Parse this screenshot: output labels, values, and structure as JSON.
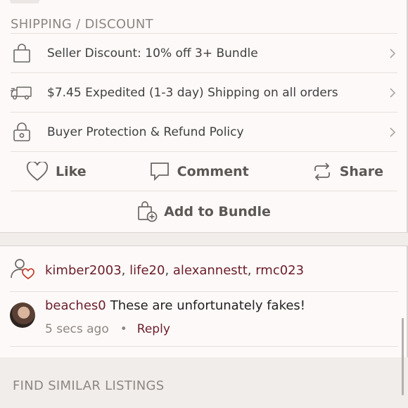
{
  "shipping": {
    "title": "SHIPPING / DISCOUNT",
    "rows": [
      {
        "icon": "shopping-bag-icon",
        "label": "Seller Discount: 10% off 3+ Bundle"
      },
      {
        "icon": "truck-icon",
        "label": "$7.45 Expedited (1-3 day) Shipping on all orders"
      },
      {
        "icon": "lock-icon",
        "label": "Buyer Protection & Refund Policy"
      }
    ]
  },
  "actions": {
    "like": "Like",
    "comment": "Comment",
    "share": "Share",
    "add_to_bundle": "Add to Bundle"
  },
  "likers": {
    "icon": "user-heart-icon",
    "names": [
      "kimber2003",
      "life20",
      "alexannestt",
      "rmc023"
    ]
  },
  "comment": {
    "user": "beaches0",
    "text": "These are unfortunately fakes!",
    "time": "5 secs ago",
    "separator": "•",
    "reply_label": "Reply"
  },
  "similar": {
    "title": "FIND SIMILAR LISTINGS"
  },
  "colors": {
    "brand": "#6a1e2b",
    "muted": "#8d8783",
    "background": "#fdf9f8"
  }
}
